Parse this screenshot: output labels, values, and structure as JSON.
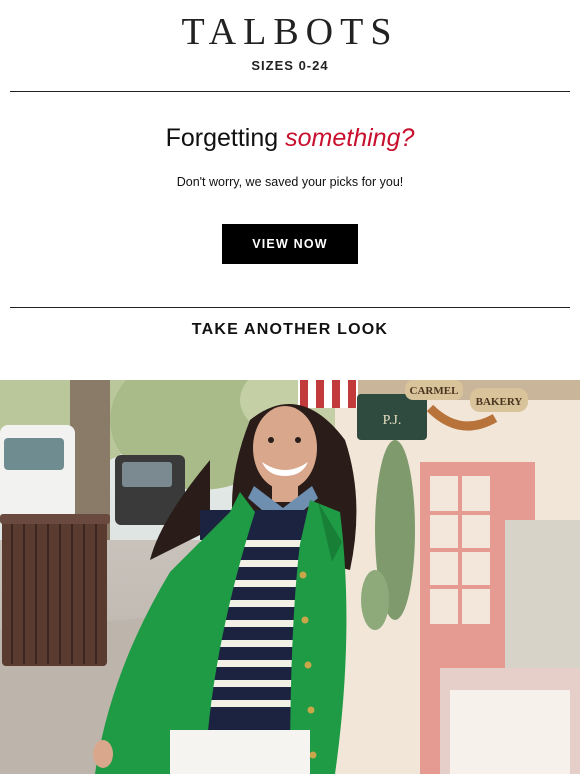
{
  "brand": {
    "logo_text": "TALBOTS",
    "tagline": "SIZES 0-24"
  },
  "hero_message": {
    "headline_plain": "Forgetting ",
    "headline_accent": "something?",
    "accent_color": "#c8102e",
    "subtext": "Don't worry, we saved your picks for you!"
  },
  "cta": {
    "label": "VIEW NOW"
  },
  "section": {
    "title": "TAKE ANOTHER LOOK"
  },
  "photo": {
    "sign_carmel": "CARMEL",
    "sign_bakery": "BAKERY",
    "sign_shop": "P.J.",
    "coat_color": "#1f9a45",
    "stripe_navy": "#1c2340"
  }
}
